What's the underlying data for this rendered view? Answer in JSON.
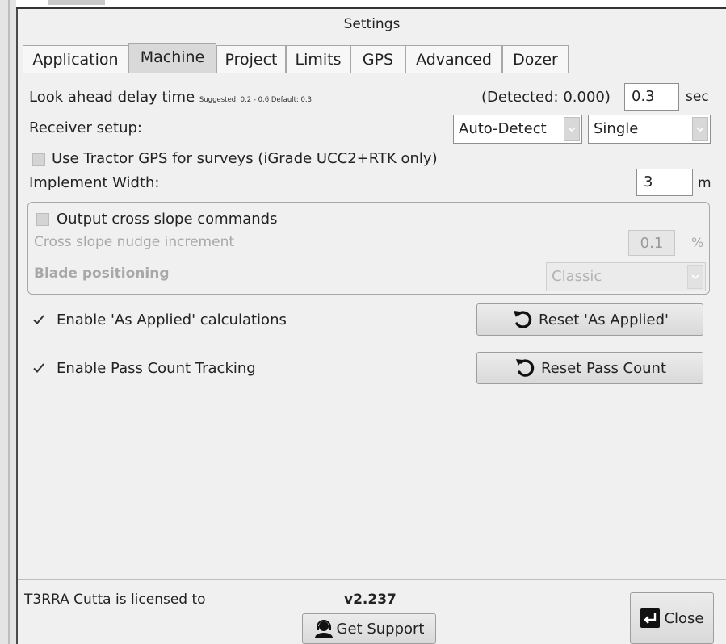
{
  "window": {
    "title": "Settings"
  },
  "tabs": [
    "Application",
    "Machine",
    "Project",
    "Limits",
    "GPS",
    "Advanced",
    "Dozer"
  ],
  "active_tab": "Machine",
  "lookahead": {
    "label": "Look ahead delay time",
    "hint": "Suggested: 0.2 - 0.6 Default: 0.3",
    "detected": "(Detected: 0.000)",
    "value": "0.3",
    "unit": "sec"
  },
  "receiver": {
    "label": "Receiver setup:",
    "mode_value": "Auto-Detect",
    "type_value": "Single"
  },
  "tractor_gps": {
    "label": "Use Tractor GPS for surveys (iGrade UCC2+RTK only)",
    "checked": false
  },
  "implement": {
    "label": "Implement Width:",
    "value": "3",
    "unit": "m"
  },
  "cross_slope": {
    "label": "Output cross slope commands",
    "checked": false,
    "nudge_label": "Cross slope nudge increment",
    "nudge_value": "0.1",
    "nudge_unit": "%",
    "blade_label": "Blade positioning",
    "blade_value": "Classic"
  },
  "as_applied": {
    "label": "Enable 'As Applied' calculations",
    "checked": true,
    "reset_label": "Reset 'As Applied'"
  },
  "pass_count": {
    "label": "Enable Pass Count Tracking",
    "checked": true,
    "reset_label": "Reset Pass Count"
  },
  "footer": {
    "license": "T3RRA Cutta is licensed to",
    "version": "v2.237",
    "support_label": "Get Support",
    "close_label": "Close"
  },
  "icons": {
    "reset": "reset-arrow-icon",
    "support": "support-headset-icon",
    "close": "exit-icon",
    "check": "checkmark-icon",
    "dropdown": "chevron-down-icon"
  }
}
